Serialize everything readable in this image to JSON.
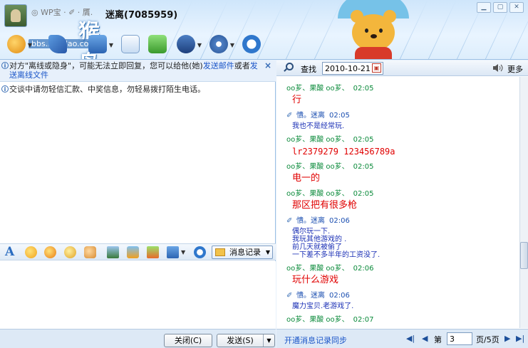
{
  "header": {
    "status_text": "◎ WP宝 · ✐ · 贋.",
    "contact_name": "迷离(7085959)",
    "logo_text": "猴岛",
    "logo_url": "bbs.houdao.com"
  },
  "notice": {
    "text": "对方\"离线或隐身\"，可能无法立即回复，您可以给他(她)",
    "link1": "发送邮件",
    "middle": "或者",
    "link2": "发送离线文件"
  },
  "tip": "交谈中请勿轻信汇款、中奖信息，勿轻易拨打陌生电话。",
  "format_bar": {
    "font_icon": "A",
    "history_label": "消息记录"
  },
  "buttons": {
    "close": "关闭(C)",
    "send": "发送(S)"
  },
  "search": {
    "label": "查找",
    "date": "2010-10-21",
    "more": "更多"
  },
  "messages": [
    {
      "sender": "oo芗、果酸 oo芗、",
      "time": "02:05",
      "me": false,
      "style": "red",
      "text": [
        "行"
      ]
    },
    {
      "sender": "憒。迷离",
      "time": "02:05",
      "me": true,
      "style": "blue",
      "text": [
        "我也不是经常玩."
      ]
    },
    {
      "sender": "oo芗、果酸 oo芗、",
      "time": "02:05",
      "me": false,
      "style": "red-mono",
      "text": [
        "lr2379279 123456789a"
      ]
    },
    {
      "sender": "oo芗、果酸 oo芗、",
      "time": "02:05",
      "me": false,
      "style": "red",
      "text": [
        "电一的"
      ]
    },
    {
      "sender": "oo芗、果酸 oo芗、",
      "time": "02:05",
      "me": false,
      "style": "red",
      "text": [
        "那区把有很多枪"
      ]
    },
    {
      "sender": "憒。迷离",
      "time": "02:06",
      "me": true,
      "style": "blue",
      "text": [
        "偶尔玩一下.",
        "我玩其他游戏的 .",
        "前几天就被偷了",
        "一下差不多半年的工资没了."
      ]
    },
    {
      "sender": "oo芗、果酸 oo芗、",
      "time": "02:06",
      "me": false,
      "style": "red",
      "text": [
        "玩什么游戏"
      ]
    },
    {
      "sender": "憒。迷离",
      "time": "02:06",
      "me": true,
      "style": "blue",
      "text": [
        "魔力宝贝.老游戏了."
      ]
    },
    {
      "sender": "oo芗、果酸 oo芗、",
      "time": "02:07",
      "me": false,
      "style": "red",
      "text": [
        ""
      ]
    }
  ],
  "pagination": {
    "sync_link": "开通消息记录同步",
    "page_label": "第",
    "page_value": "3",
    "total": "页/5页"
  },
  "colors": {
    "link": "#1a55c8",
    "peer_name": "#0a8a3a",
    "self_name": "#1a4eb0",
    "peer_text": "#e00000",
    "self_text": "#1a2fb5"
  }
}
